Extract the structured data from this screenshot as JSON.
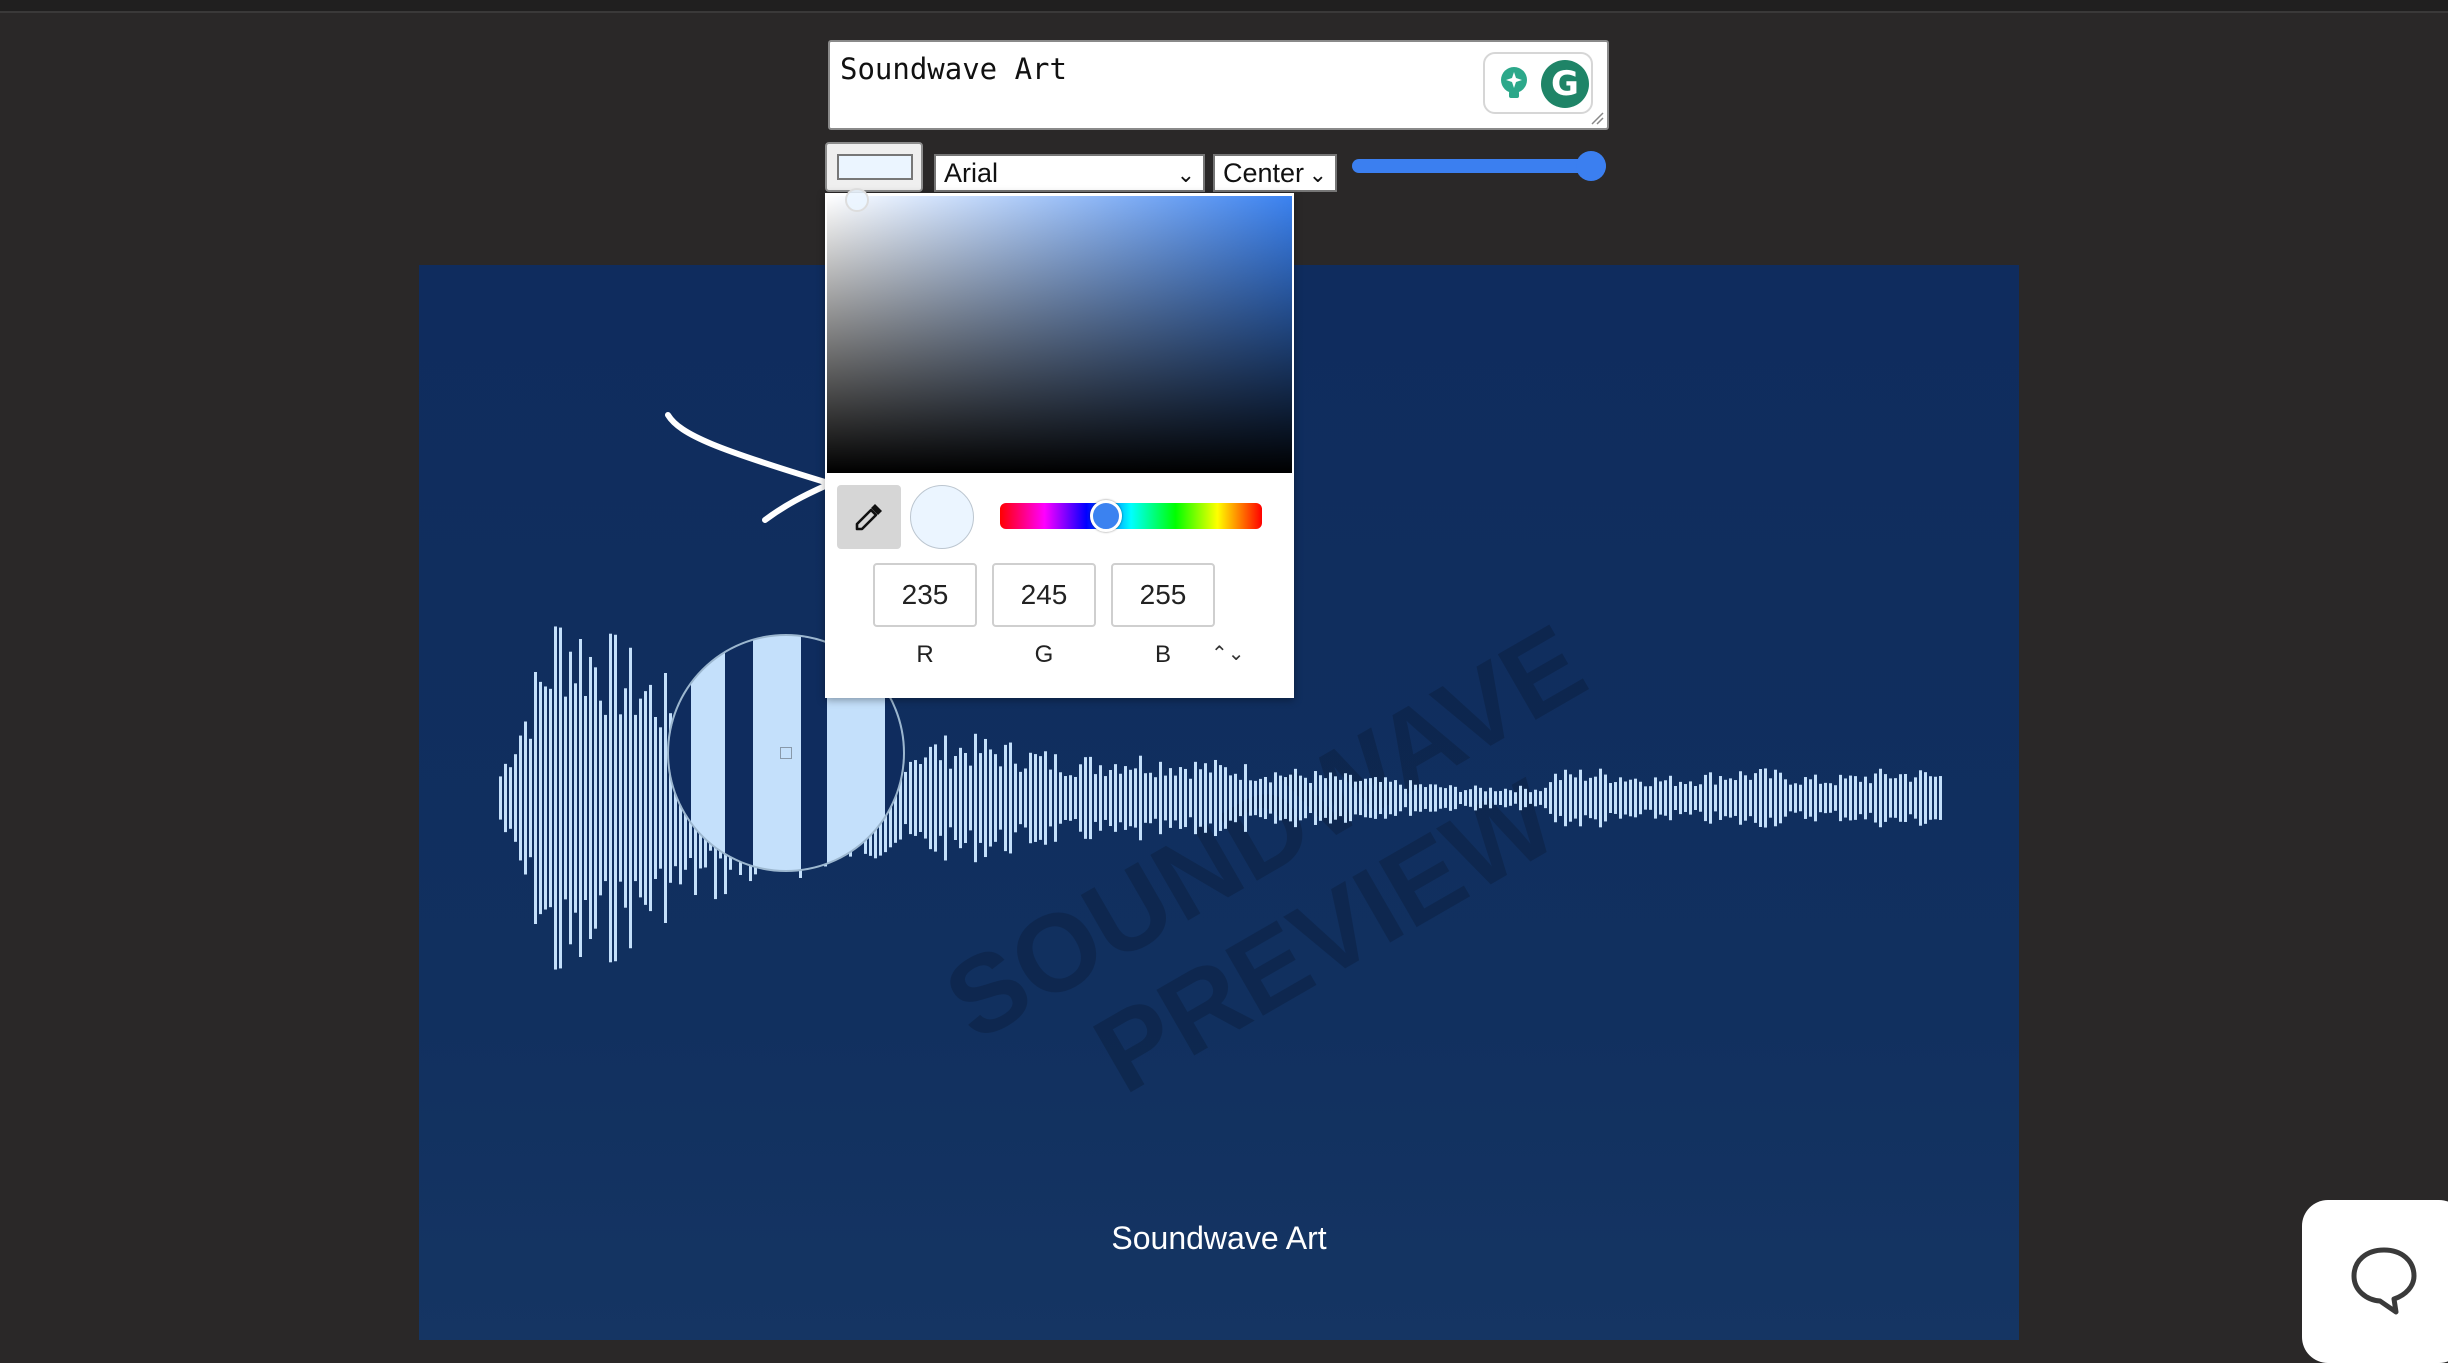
{
  "editor": {
    "title_value": "Soundwave Art",
    "font": "Arial",
    "alignment": "Center",
    "size_level": 1.0
  },
  "canvas": {
    "caption": "Soundwave Art",
    "watermark": "SOUNDWAVE\nPREVIEW",
    "background": "#0f2c5e",
    "wave_color": "#c4e0fb"
  },
  "picker": {
    "r": "235",
    "g": "245",
    "b": "255",
    "label_r": "R",
    "label_g": "G",
    "label_b": "B",
    "mode_toggle": "⌃⌄",
    "selected_color": "#ebf5ff",
    "hue_color": "#3b82f0"
  },
  "icons": {
    "extension": "grammarly-g-icon",
    "bulb": "lightbulb-icon",
    "eyedropper": "eyedropper-icon",
    "chat": "chat-bubble-icon"
  },
  "grammarly_letter": "G"
}
